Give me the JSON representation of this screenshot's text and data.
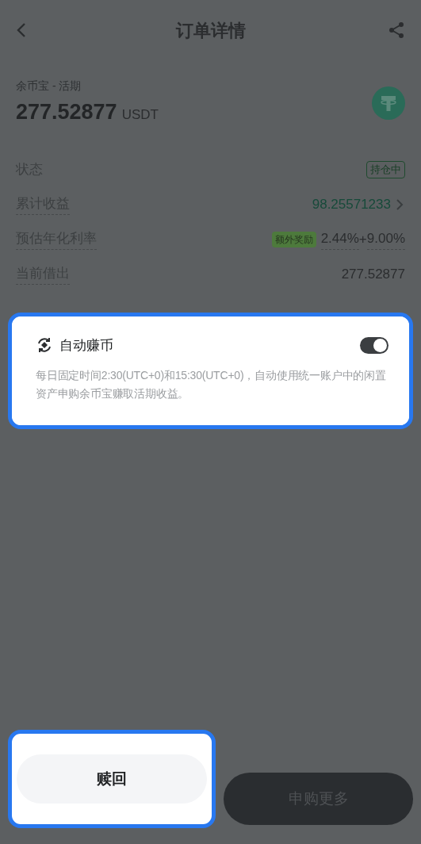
{
  "header": {
    "title": "订单详情"
  },
  "asset": {
    "product": "余币宝 - 活期",
    "amount": "277.52877",
    "unit": "USDT"
  },
  "details": [
    {
      "kind": "badge",
      "label": "状态",
      "value": "持仓中"
    },
    {
      "kind": "link",
      "label": "累计收益",
      "value": "98.25571233"
    },
    {
      "kind": "rate",
      "label": "预估年化利率",
      "tag": "额外奖励",
      "base": "2.44%",
      "plus": "+",
      "bonus": "9.00%"
    },
    {
      "kind": "plain",
      "label": "当前借出",
      "value": "277.52877"
    }
  ],
  "auto_earn": {
    "title": "自动赚币",
    "on": true,
    "description": "每日固定时间2:30(UTC+0)和15:30(UTC+0)，自动使用统一账户中的闲置资产申购余币宝赚取活期收益。"
  },
  "buttons": [
    {
      "label": "赎回",
      "highlighted": true
    },
    {
      "label": "申购更多",
      "highlighted": false
    }
  ]
}
